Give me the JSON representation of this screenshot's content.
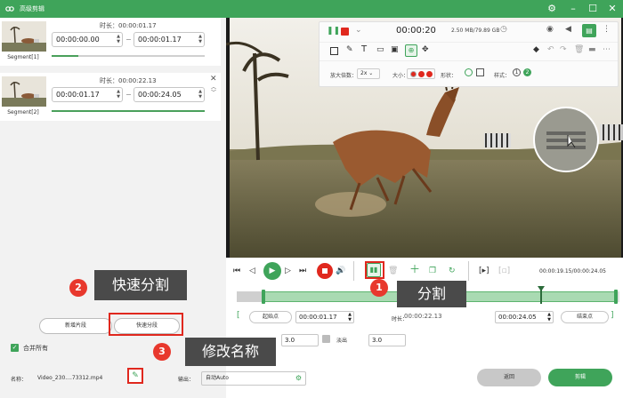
{
  "app": {
    "title": "高级剪辑"
  },
  "segments": [
    {
      "label": "Segment[1]",
      "duration_label": "时长：00:00:01.17",
      "start": "00:00:00.00",
      "end": "00:00:01.17"
    },
    {
      "label": "Segment[2]",
      "duration_label": "时长：00:00:22.13",
      "start": "00:00:01.17",
      "end": "00:00:24.05"
    }
  ],
  "left_buttons": {
    "new_segment": "新增片段",
    "quick_split": "快速分段"
  },
  "merge": {
    "label": "合并所有",
    "checked": true
  },
  "file": {
    "name_label": "名称：",
    "name_value": "Video_230....73312.mp4",
    "output_label": "输出：",
    "output_value": "自动Auto"
  },
  "footer": {
    "back": "返回",
    "cut": "剪辑"
  },
  "recorder": {
    "time": "00:00:20",
    "size": "2.50 MB/79.89 GB",
    "zoom_label": "放大倍数：",
    "zoom_value": "2x",
    "size_label": "大小：",
    "shape_label": "形状：",
    "style_label": "样式：",
    "style_num1": "1",
    "style_num2": "2"
  },
  "player": {
    "time_readout": "00:00:19.15/00:00:24.05"
  },
  "trim": {
    "start_label": "起始点",
    "start_value": "00:00:01.17",
    "duration_label": "时长：",
    "duration_value": "00:00:22.13",
    "end_value": "00:00:24.05",
    "end_label": "结束点"
  },
  "fade": {
    "fade_in_value": "3.0",
    "fade_out_label": "淡出",
    "fade_out_value": "3.0"
  },
  "annotations": {
    "a1_num": "1",
    "a1_text": "分割",
    "a2_num": "2",
    "a2_text": "快速分割",
    "a3_num": "3",
    "a3_text": "修改名称"
  },
  "colors": {
    "brand": "#3fa45a",
    "annot_red": "#e8382d",
    "annot_bg": "#4a4a4a"
  }
}
